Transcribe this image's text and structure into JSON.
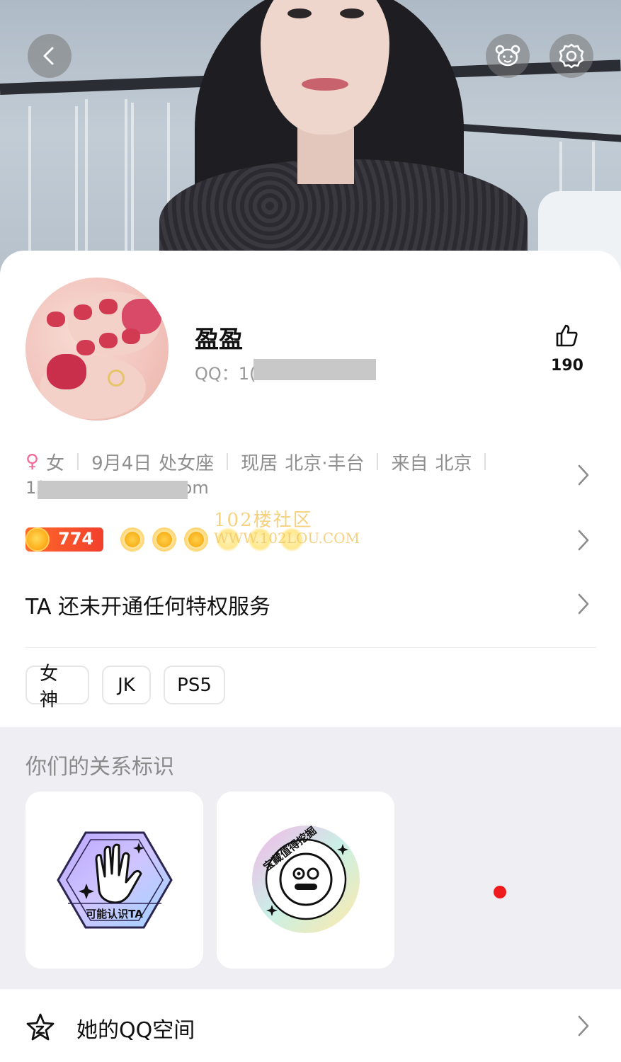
{
  "header": {
    "back_icon": "chevron-left-icon",
    "pet_icon": "pet-bear-icon",
    "settings_icon": "gear-icon"
  },
  "profile": {
    "name": "盈盈",
    "qq_prefix": "QQ：1(",
    "likes": "190",
    "like_icon": "thumbs-up-icon"
  },
  "info": {
    "gender_symbol": "♀",
    "gender": "女",
    "birthday": "9月4日",
    "zodiac": "处女座",
    "residence_label": "现居",
    "residence": "北京·丰台",
    "origin_label": "来自",
    "origin": "北京",
    "email_prefix": "1(",
    "email_suffix": "om"
  },
  "level": {
    "value": "774",
    "watermark_line1": "102楼社区",
    "watermark_line2": "WWW.102LOU.COM"
  },
  "privilege": {
    "text": "TA 还未开通任何特权服务"
  },
  "tags": [
    "女神",
    "JK",
    "PS5"
  ],
  "relation": {
    "title": "你们的关系标识",
    "badges": [
      {
        "label": "可能认识TA"
      },
      {
        "label": "宝藏值得挖掘"
      }
    ]
  },
  "qzone": {
    "label": "她的QQ空间",
    "icon": "qzone-star-icon"
  },
  "colors": {
    "accent_female": "#f06a9a",
    "level_badge": "#f23f2c",
    "red_dot": "#ee1c1c",
    "section_bg": "#efeff3"
  }
}
